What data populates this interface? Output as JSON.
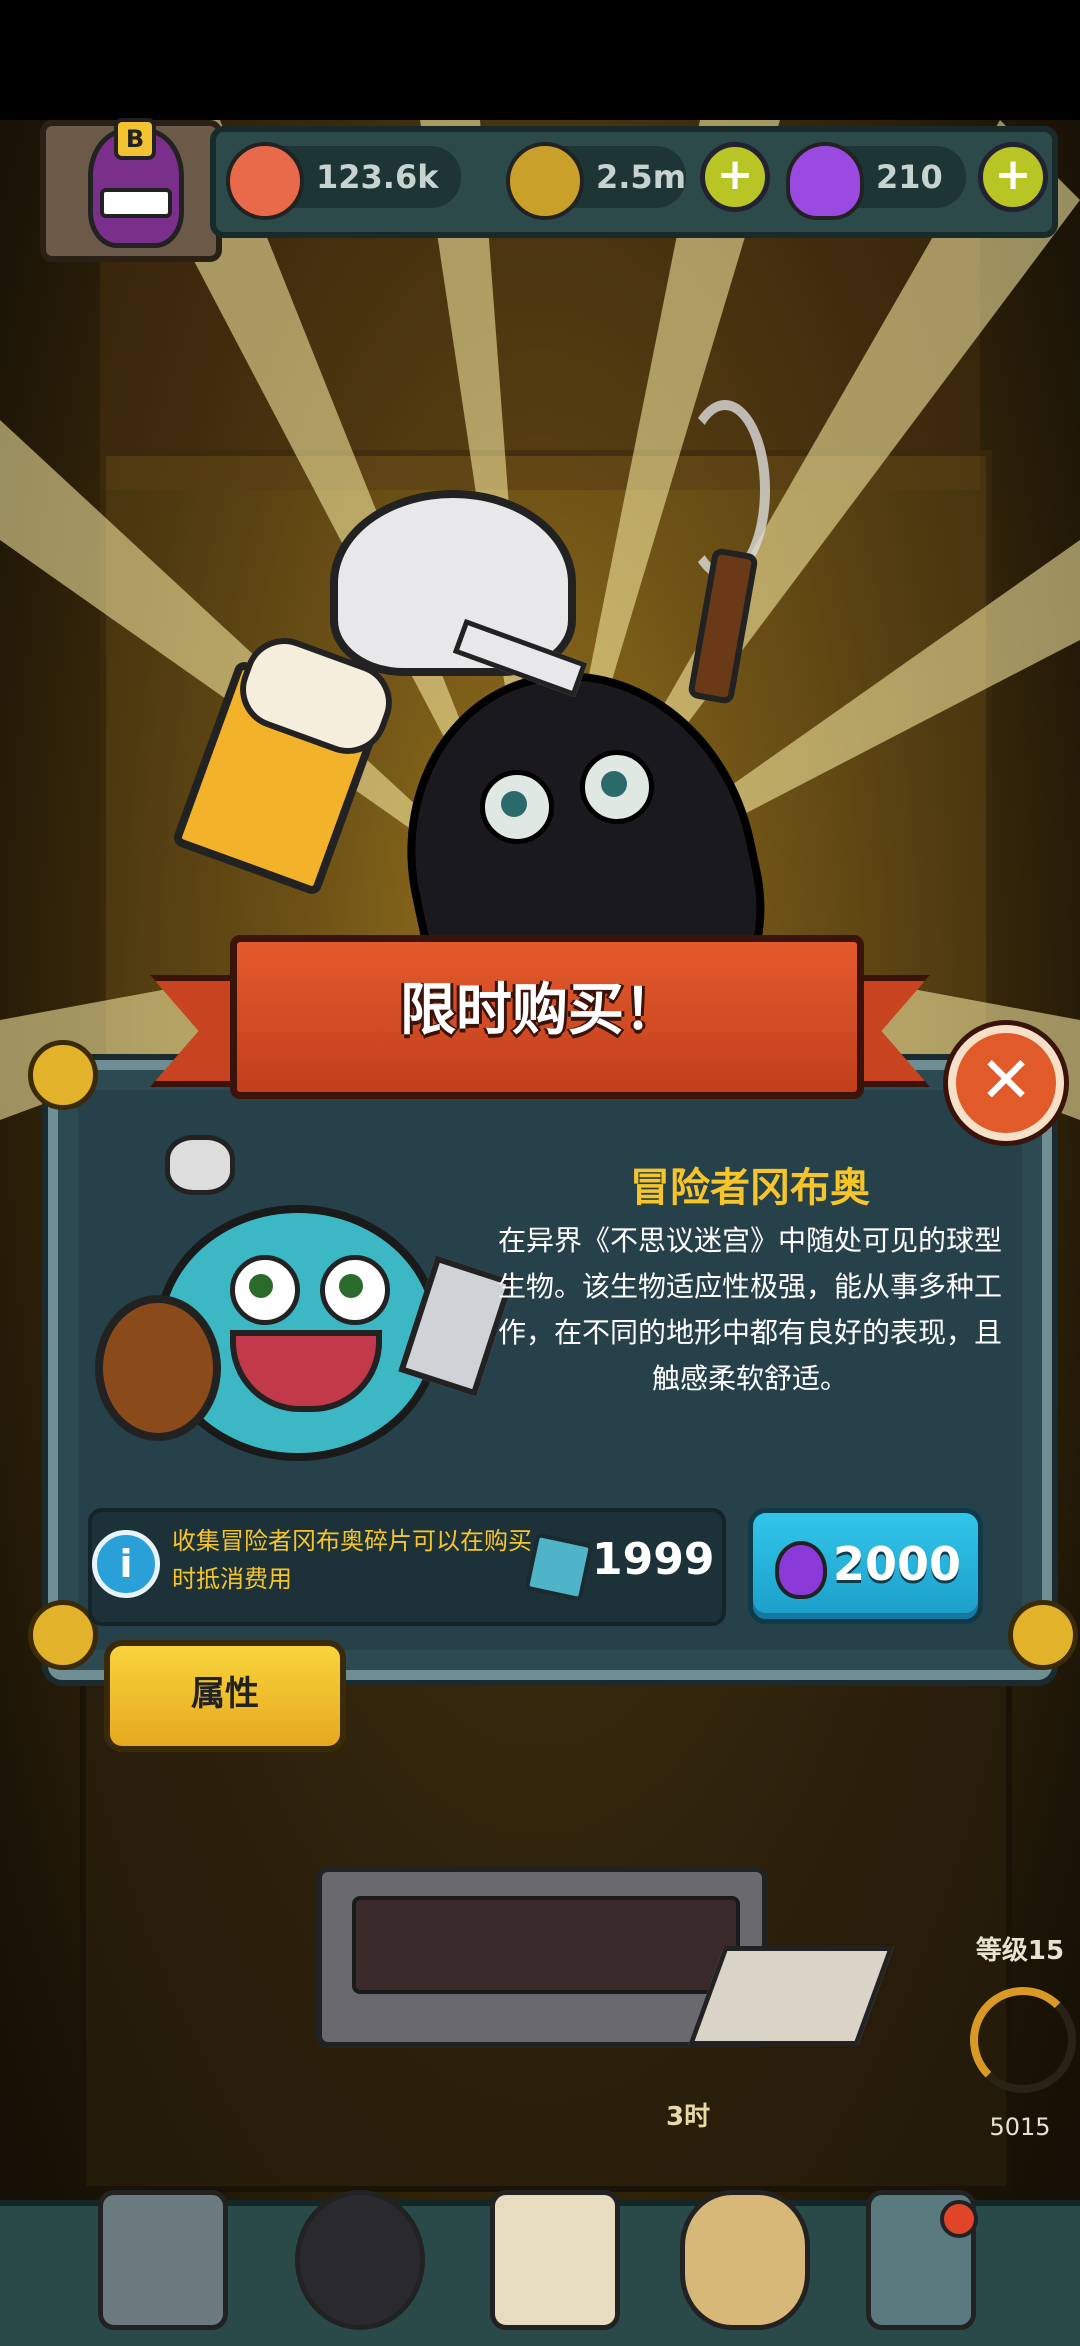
{
  "resources": {
    "eyeballs": "123.6k",
    "coins": "2.5m",
    "potions": "210",
    "plus": "+"
  },
  "avatar": {
    "badge": "B"
  },
  "popup": {
    "banner_title": "限时购买！",
    "close_glyph": "✕",
    "item_name": "冒险者冈布奥",
    "description": "在异界《不思议迷宫》中随处可见的球型生物。该生物适应性极强，能从事多种工作，在不同的地形中都有良好的表现，且触感柔软舒适。",
    "info_glyph": "i",
    "info_text": "收集冒险者冈布奥碎片可以在购买时抵消费用",
    "shard_count": "1999",
    "price": "2000",
    "attributes_tab": "属性"
  },
  "side": {
    "level": "等级15",
    "counter": "5015"
  },
  "scene": {
    "room_label": "3时"
  },
  "colors": {
    "accent_gold": "#f7c52a",
    "buy_blue": "#1a9ec8",
    "banner_red": "#c8431f",
    "panel_teal": "#2d4a52"
  },
  "icons": [
    "eyeball-icon",
    "coin-icon",
    "potion-icon",
    "plus-icon",
    "close-icon",
    "info-icon",
    "shard-icon",
    "castle-icon",
    "monster-icon",
    "book-icon",
    "coin-bag-icon",
    "grid-icon"
  ]
}
